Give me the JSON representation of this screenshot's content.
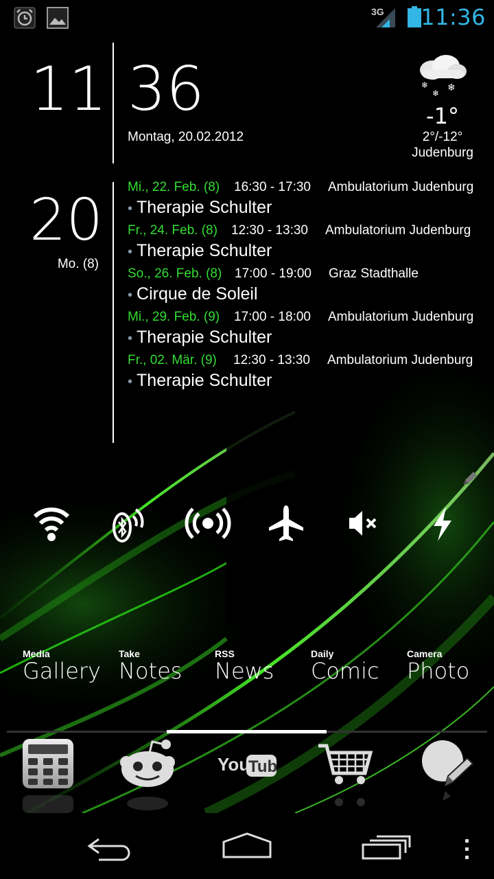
{
  "status_bar": {
    "clock": "11:36",
    "network_label": "3G",
    "left_icons": [
      "alarm-icon",
      "image-icon"
    ],
    "accent_color": "#33b5e5"
  },
  "clock_widget": {
    "hour": "11",
    "minute": "36",
    "date": "Montag, 20.02.2012"
  },
  "weather": {
    "icon": "snow-cloud-icon",
    "temperature": "-1°",
    "range": "2°/-12°",
    "city": "Judenburg"
  },
  "calendar": {
    "day": "20",
    "weekday": "Mo. (8)",
    "events": [
      {
        "date": "Mi., 22. Feb. (8)",
        "time": "16:30 - 17:30",
        "location": "Ambulatorium Judenburg",
        "title": "Therapie Schulter"
      },
      {
        "date": "Fr., 24. Feb. (8)",
        "time": "12:30 - 13:30",
        "location": "Ambulatorium Judenburg",
        "title": "Therapie Schulter"
      },
      {
        "date": "So., 26. Feb. (8)",
        "time": "17:00 - 19:00",
        "location": "Graz Stadthalle",
        "title": "Cirque de Soleil"
      },
      {
        "date": "Mi., 29. Feb. (9)",
        "time": "17:00 - 18:00",
        "location": "Ambulatorium Judenburg",
        "title": "Therapie Schulter"
      },
      {
        "date": "Fr., 02. Mär. (9)",
        "time": "12:30 - 13:30",
        "location": "Ambulatorium Judenburg",
        "title": "Therapie Schulter"
      }
    ],
    "date_color": "#33dd33"
  },
  "toggles": [
    "wifi-icon",
    "bluetooth-icon",
    "hotspot-icon",
    "airplane-icon",
    "mute-icon",
    "flash-icon"
  ],
  "shortcuts": [
    {
      "small": "Media",
      "big": "Gallery"
    },
    {
      "small": "Take",
      "big": "Notes"
    },
    {
      "small": "RSS",
      "big": "News"
    },
    {
      "small": "Daily",
      "big": "Comic"
    },
    {
      "small": "Camera",
      "big": "Photo"
    }
  ],
  "dock": {
    "apps": [
      "calculator-icon",
      "reddit-icon",
      "youtube-icon",
      "shopping-cart-icon",
      "paint-icon"
    ],
    "youtube_you": "You",
    "youtube_tube": "Tube"
  },
  "nav_bar": [
    "back-icon",
    "home-icon",
    "recents-icon",
    "menu-icon"
  ]
}
